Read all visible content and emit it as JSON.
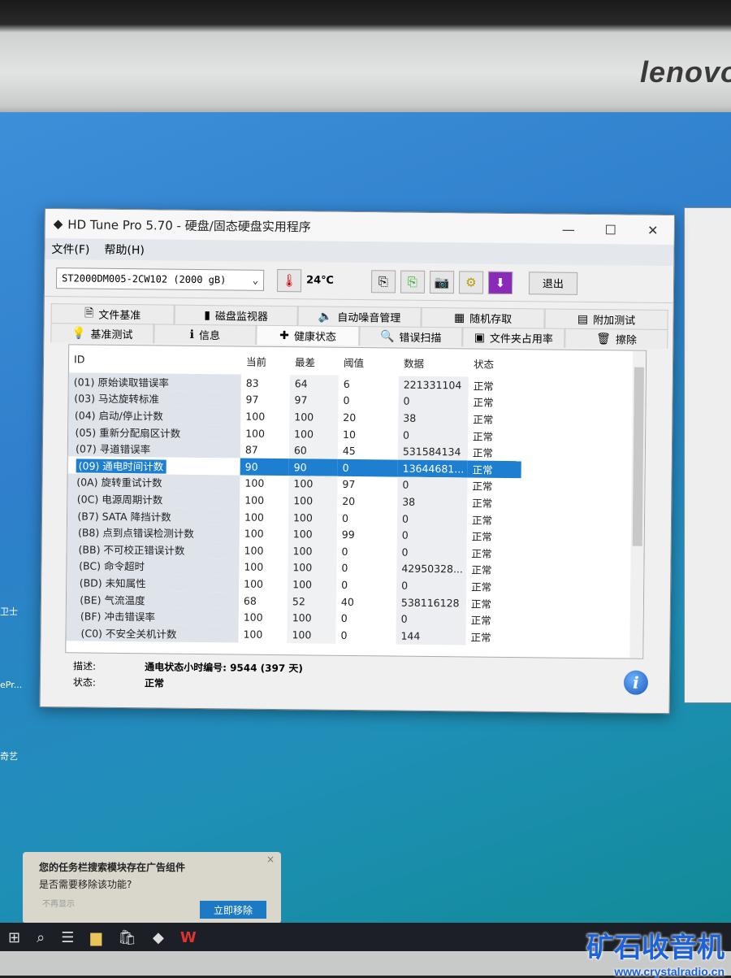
{
  "monitor": {
    "brand": "lenovo"
  },
  "desktop": {
    "icons": [
      {
        "label": "卫士"
      },
      {
        "label": "ePr..."
      },
      {
        "label": "奇艺"
      }
    ]
  },
  "window": {
    "title": "HD Tune Pro 5.70 - 硬盘/固态硬盘实用程序",
    "controls": {
      "minimize": "—",
      "maximize": "☐",
      "close": "✕"
    },
    "menu": [
      "文件(F)",
      "帮助(H)"
    ],
    "drive": "ST2000DM005-2CW102 (2000 gB)",
    "temperature": "24℃",
    "exit_label": "退出",
    "tabs_top": [
      {
        "label": "文件基准",
        "icon": "🗎"
      },
      {
        "label": "磁盘监视器",
        "icon": "▮"
      },
      {
        "label": "自动噪音管理",
        "icon": "🔈"
      },
      {
        "label": "随机存取",
        "icon": "▦"
      },
      {
        "label": "附加测试",
        "icon": "▤"
      }
    ],
    "tabs_bottom": [
      {
        "label": "基准测试",
        "icon": "💡"
      },
      {
        "label": "信息",
        "icon": "ℹ"
      },
      {
        "label": "健康状态",
        "icon": "✚"
      },
      {
        "label": "错误扫描",
        "icon": "🔍"
      },
      {
        "label": "文件夹占用率",
        "icon": "▣"
      },
      {
        "label": "擦除",
        "icon": "🗑"
      }
    ],
    "active_tab": "健康状态",
    "columns": [
      "ID",
      "当前",
      "最差",
      "阈值",
      "数据",
      "状态"
    ],
    "rows": [
      [
        "(01) 原始读取错误率",
        "83",
        "64",
        "6",
        "221331104",
        "正常"
      ],
      [
        "(03) 马达旋转标准",
        "97",
        "97",
        "0",
        "0",
        "正常"
      ],
      [
        "(04) 启动/停止计数",
        "100",
        "100",
        "20",
        "38",
        "正常"
      ],
      [
        "(05) 重新分配扇区计数",
        "100",
        "100",
        "10",
        "0",
        "正常"
      ],
      [
        "(07) 寻道错误率",
        "87",
        "60",
        "45",
        "531584134",
        "正常"
      ],
      [
        "(09) 通电时间计数",
        "90",
        "90",
        "0",
        "13644681...",
        "正常"
      ],
      [
        "(0A) 旋转重试计数",
        "100",
        "100",
        "97",
        "0",
        "正常"
      ],
      [
        "(0C) 电源周期计数",
        "100",
        "100",
        "20",
        "38",
        "正常"
      ],
      [
        "(B7) SATA 降挡计数",
        "100",
        "100",
        "0",
        "0",
        "正常"
      ],
      [
        "(B8) 点到点错误检测计数",
        "100",
        "100",
        "99",
        "0",
        "正常"
      ],
      [
        "(BB) 不可校正错误计数",
        "100",
        "100",
        "0",
        "0",
        "正常"
      ],
      [
        "(BC) 命令超时",
        "100",
        "100",
        "0",
        "42950328...",
        "正常"
      ],
      [
        "(BD) 未知属性",
        "100",
        "100",
        "0",
        "0",
        "正常"
      ],
      [
        "(BE) 气流温度",
        "68",
        "52",
        "40",
        "538116128",
        "正常"
      ],
      [
        "(BF) 冲击错误率",
        "100",
        "100",
        "0",
        "0",
        "正常"
      ],
      [
        "(C0) 不安全关机计数",
        "100",
        "100",
        "0",
        "144",
        "正常"
      ]
    ],
    "selected_row": 5,
    "description_label": "描述:",
    "description_value": "通电状态小时编号: 9544 (397 天)",
    "status_label": "状态:",
    "status_value": "正常"
  },
  "popup": {
    "title": "您的任务栏搜索模块存在广告组件",
    "question": "是否需要移除该功能?",
    "dismiss": "不再显示",
    "action": "立即移除",
    "close": "×"
  },
  "watermark": {
    "name": "矿石收音机",
    "url": "www.crystalradio.cn"
  }
}
